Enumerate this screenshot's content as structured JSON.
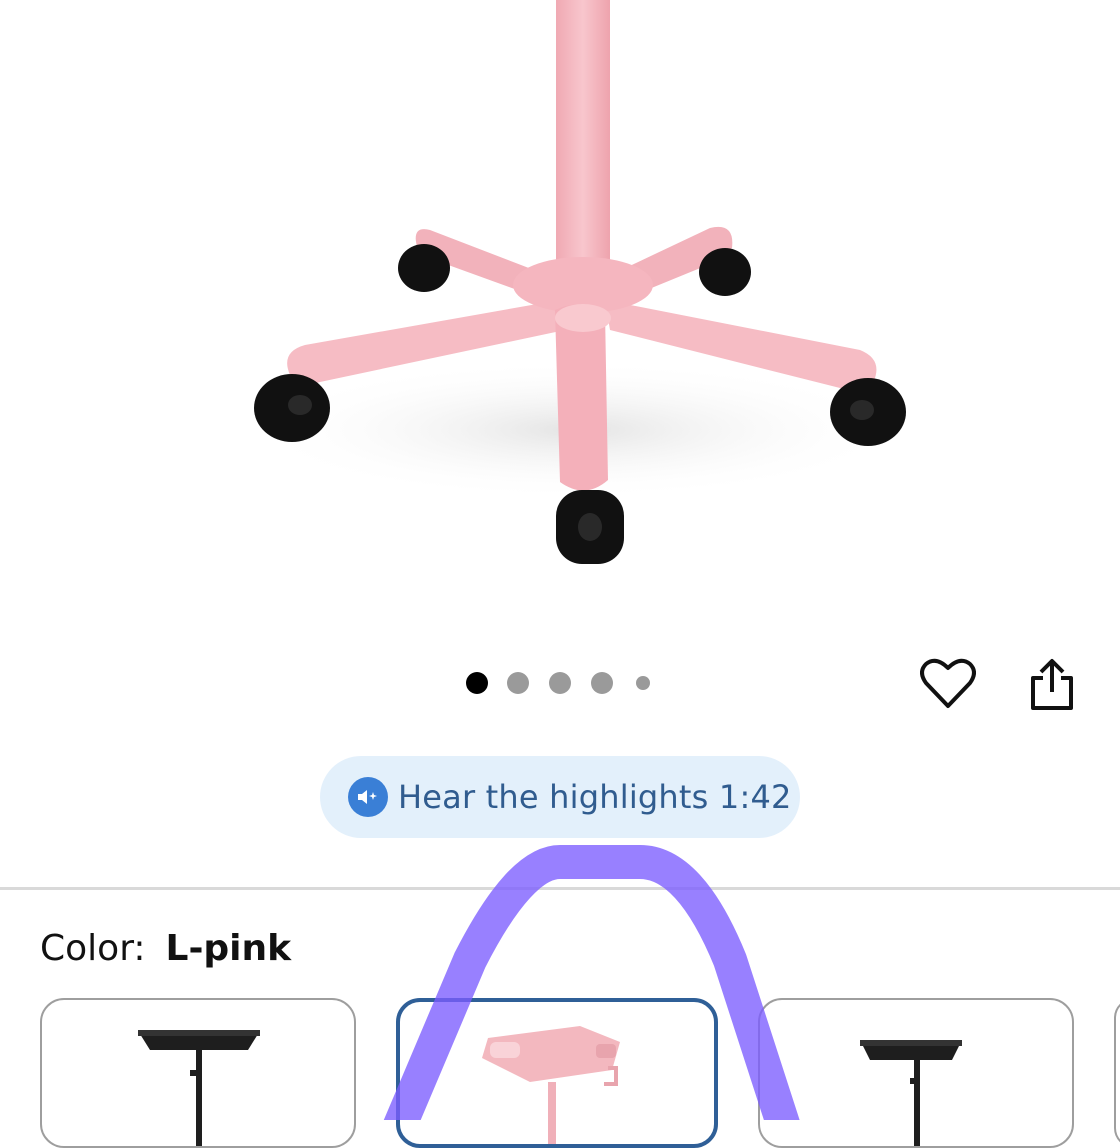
{
  "gallery": {
    "image_alt_icon": "office-chair-base-icon",
    "dots": 5,
    "active_dot": 0,
    "wishlist_icon": "heart-outline-icon",
    "share_icon": "share-icon"
  },
  "highlights": {
    "icon": "speaker-sparkle-icon",
    "label": "Hear the highlights 1:42"
  },
  "variant": {
    "label": "Color:",
    "selected": "L-pink",
    "swatches": [
      {
        "name": "black-tray-stand",
        "color": "#1e1e1e"
      },
      {
        "name": "pink-tray-stand",
        "color": "#f3b8bf"
      },
      {
        "name": "black-tray-stand-2",
        "color": "#1e1e1e"
      }
    ]
  },
  "colors": {
    "pink": "#f4b7bf",
    "wheel": "#111111",
    "accent_blue": "#2f5f97",
    "pill_bg": "#e3f0fb",
    "annotation": "#7b5cff"
  }
}
